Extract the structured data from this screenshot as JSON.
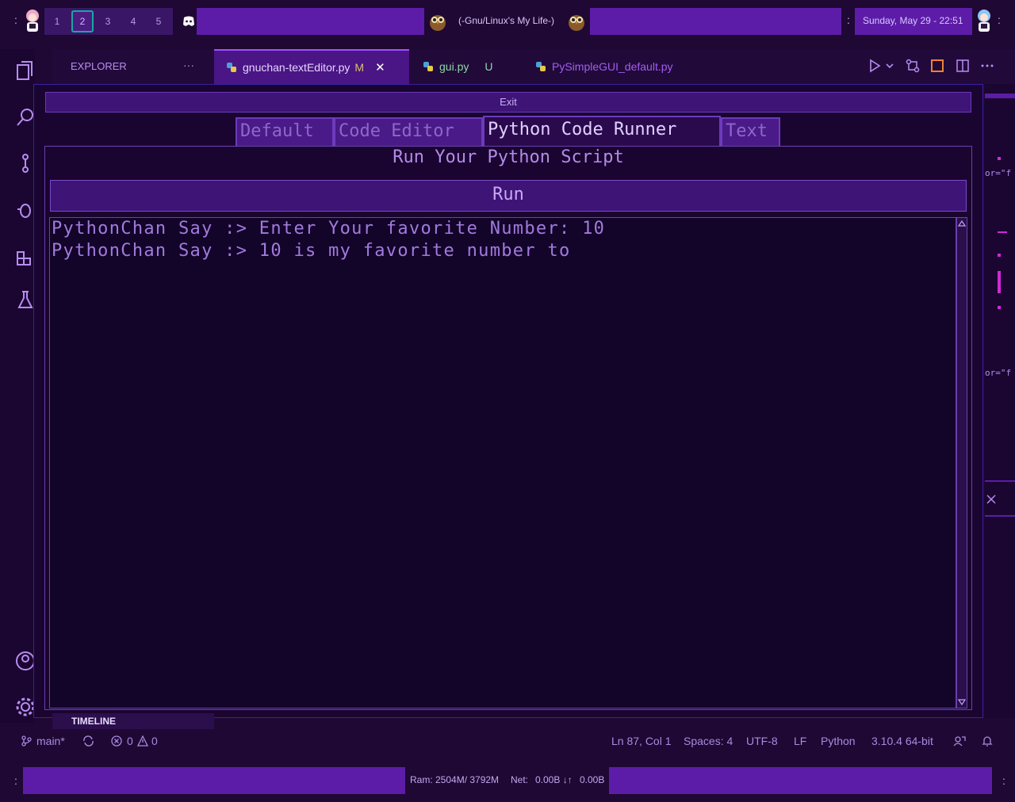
{
  "topbar": {
    "workspaces": [
      "1",
      "2",
      "3",
      "4",
      "5"
    ],
    "active_workspace": "2",
    "window_title": "(-Gnu/Linux's My Life-)",
    "datetime": "Sunday, May 29 - 22:51",
    "separator": ":"
  },
  "editor": {
    "explorer_title": "EXPLORER",
    "explorer_more": "···",
    "tabs": [
      {
        "label": "gnuchan-textEditor.py",
        "badge": "M",
        "close": "✕"
      },
      {
        "label": "gui.py",
        "badge": "U"
      },
      {
        "label": "PySimpleGUI_default.py"
      }
    ],
    "timeline_label": "TIMELINE"
  },
  "app": {
    "exit_label": "Exit",
    "tabs": [
      "Default",
      "Code Editor",
      "Python Code Runner",
      "Text"
    ],
    "selected_tab": "Python Code Runner",
    "heading": "Run Your Python Script",
    "run_label": "Run",
    "output_lines": [
      "PythonChan Say :> Enter Your favorite Number: 10",
      "PythonChan Say :> 10 is my favorite number to"
    ]
  },
  "peek": {
    "snippet": "or=\"f"
  },
  "statusbar": {
    "branch": "main*",
    "errors": "0",
    "warnings": "0",
    "position": "Ln 87, Col 1",
    "spaces": "Spaces: 4",
    "encoding": "UTF-8",
    "eol": "LF",
    "language": "Python",
    "interpreter": "3.10.4 64-bit"
  },
  "bottombar": {
    "ram": "Ram:  2504M/ 3792M",
    "net_label": "Net:",
    "net_down": "0.00B ↓↑",
    "net_up": "0.00B"
  },
  "colors": {
    "accent": "#5d1ca8",
    "background": "#1a0530",
    "text": "#a27adc"
  }
}
